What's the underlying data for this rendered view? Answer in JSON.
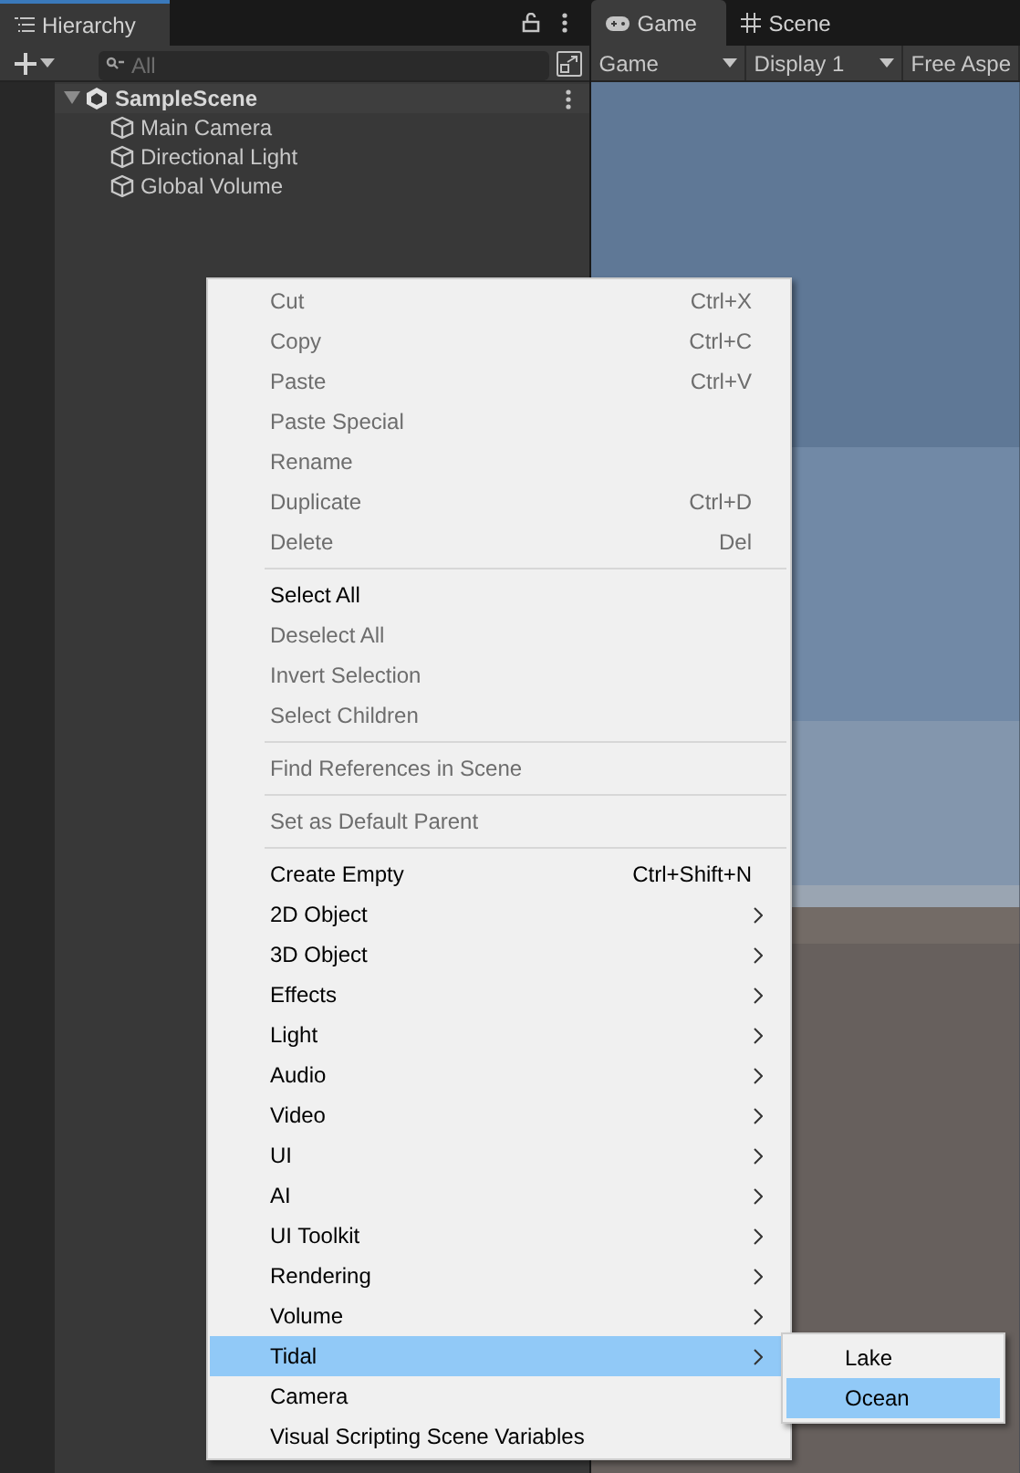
{
  "hierarchy": {
    "tab": {
      "title": "Hierarchy",
      "selected": true
    },
    "search": {
      "placeholder": "All"
    },
    "scene": {
      "name": "SampleScene",
      "expanded": true,
      "children": [
        {
          "name": "Main Camera"
        },
        {
          "name": "Directional Light"
        },
        {
          "name": "Global Volume"
        }
      ]
    }
  },
  "game_view": {
    "tabs": [
      {
        "label": "Game",
        "kind": "game",
        "selected": true
      },
      {
        "label": "Scene",
        "kind": "scene",
        "selected": false
      }
    ],
    "toolbar": [
      {
        "label": "Game",
        "dropdown": true
      },
      {
        "label": "Display 1",
        "dropdown": true
      },
      {
        "label": "Free Aspe",
        "dropdown": false
      }
    ]
  },
  "context_menu": {
    "items": [
      {
        "kind": "item",
        "label": "Cut",
        "shortcut": "Ctrl+X",
        "disabled": true
      },
      {
        "kind": "item",
        "label": "Copy",
        "shortcut": "Ctrl+C",
        "disabled": true
      },
      {
        "kind": "item",
        "label": "Paste",
        "shortcut": "Ctrl+V",
        "disabled": true
      },
      {
        "kind": "item",
        "label": "Paste Special",
        "disabled": true
      },
      {
        "kind": "item",
        "label": "Rename",
        "disabled": true
      },
      {
        "kind": "item",
        "label": "Duplicate",
        "shortcut": "Ctrl+D",
        "disabled": true
      },
      {
        "kind": "item",
        "label": "Delete",
        "shortcut": "Del",
        "disabled": true
      },
      {
        "kind": "separator"
      },
      {
        "kind": "item",
        "label": "Select All",
        "disabled": false
      },
      {
        "kind": "item",
        "label": "Deselect All",
        "disabled": true
      },
      {
        "kind": "item",
        "label": "Invert Selection",
        "disabled": true
      },
      {
        "kind": "item",
        "label": "Select Children",
        "disabled": true
      },
      {
        "kind": "separator"
      },
      {
        "kind": "item",
        "label": "Find References in Scene",
        "disabled": true
      },
      {
        "kind": "separator"
      },
      {
        "kind": "item",
        "label": "Set as Default Parent",
        "disabled": true
      },
      {
        "kind": "separator"
      },
      {
        "kind": "item",
        "label": "Create Empty",
        "shortcut": "Ctrl+Shift+N",
        "disabled": false
      },
      {
        "kind": "item",
        "label": "2D Object",
        "submenu": true,
        "disabled": false
      },
      {
        "kind": "item",
        "label": "3D Object",
        "submenu": true,
        "disabled": false
      },
      {
        "kind": "item",
        "label": "Effects",
        "submenu": true,
        "disabled": false
      },
      {
        "kind": "item",
        "label": "Light",
        "submenu": true,
        "disabled": false
      },
      {
        "kind": "item",
        "label": "Audio",
        "submenu": true,
        "disabled": false
      },
      {
        "kind": "item",
        "label": "Video",
        "submenu": true,
        "disabled": false
      },
      {
        "kind": "item",
        "label": "UI",
        "submenu": true,
        "disabled": false
      },
      {
        "kind": "item",
        "label": "AI",
        "submenu": true,
        "disabled": false
      },
      {
        "kind": "item",
        "label": "UI Toolkit",
        "submenu": true,
        "disabled": false
      },
      {
        "kind": "item",
        "label": "Rendering",
        "submenu": true,
        "disabled": false
      },
      {
        "kind": "item",
        "label": "Volume",
        "submenu": true,
        "disabled": false
      },
      {
        "kind": "item",
        "label": "Tidal",
        "submenu": true,
        "disabled": false,
        "selected": true
      },
      {
        "kind": "item",
        "label": "Camera",
        "disabled": false
      },
      {
        "kind": "item",
        "label": "Visual Scripting Scene Variables",
        "disabled": false
      }
    ],
    "submenu": {
      "items": [
        {
          "label": "Lake",
          "selected": false
        },
        {
          "label": "Ocean",
          "selected": true
        }
      ]
    }
  }
}
